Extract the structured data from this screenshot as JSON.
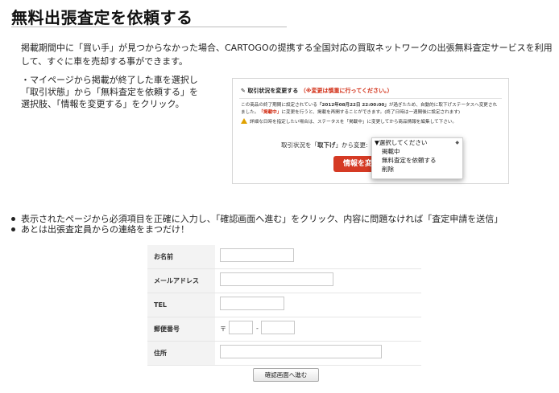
{
  "page": {
    "title": "無料出張査定を依頼する",
    "intro": "掲載期間中に「買い手」が見つからなかった場合、CARTOGOの提携する全国対応の買取ネットワークの出張無料査定サービスを利用して、すぐに車を売却する事ができます。",
    "step1": "・マイページから掲載が終了した車を選択し「取引状態」から「無料査定を依頼する」を選択肢、「情報を変更する」をクリック。"
  },
  "screenshot": {
    "heading": "取引状況を変更する",
    "heading_warning": "（※変更は慎重に行ってください。）",
    "notice_part1": "この商品の終了期間に設定されている",
    "notice_date": "「2012年08月22日 22:00:00」",
    "notice_part2": "が過ぎたため、自動的に取下げステータスへ変更されました。",
    "notice_state": "「掲載中」",
    "notice_part3": "に変更を行うと、掲載を再開することができます。(終了日時は一週間後に設定されます)",
    "warning_line": "詳細な日時を指定したい場合は、ステータスを「掲載中」に変更してから商品情報を編集して下さい。",
    "status_label_pre": "取引状況を「",
    "status_value": "取下げ",
    "status_label_post": "」から変更:",
    "button_label": "情報を変",
    "dropdown_options": [
      "▼選択してください",
      "掲載中",
      "無料査定を依頼する",
      "削除"
    ]
  },
  "bullets": [
    "表示されたページから必須項目を正確に入力し、「確認画面へ進む」をクリック、内容に問題なければ「査定申請を送信」",
    "あとは出張査定員からの連絡をまつだけ！"
  ],
  "form": {
    "name_label": "お名前",
    "email_label": "メールアドレス",
    "tel_label": "TEL",
    "zip_label": "郵便番号",
    "zip_mark": "〒",
    "zip_dash": "-",
    "address_label": "住所",
    "name_value": "",
    "email_value": "",
    "tel_value": "",
    "zip1_value": "",
    "zip2_value": "",
    "address_value": ""
  },
  "submit_label": "確認画面へ進む",
  "colors": {
    "accent_red": "#d53a24",
    "warning_red": "#d12b12",
    "label_bg": "#f3f3f3"
  }
}
